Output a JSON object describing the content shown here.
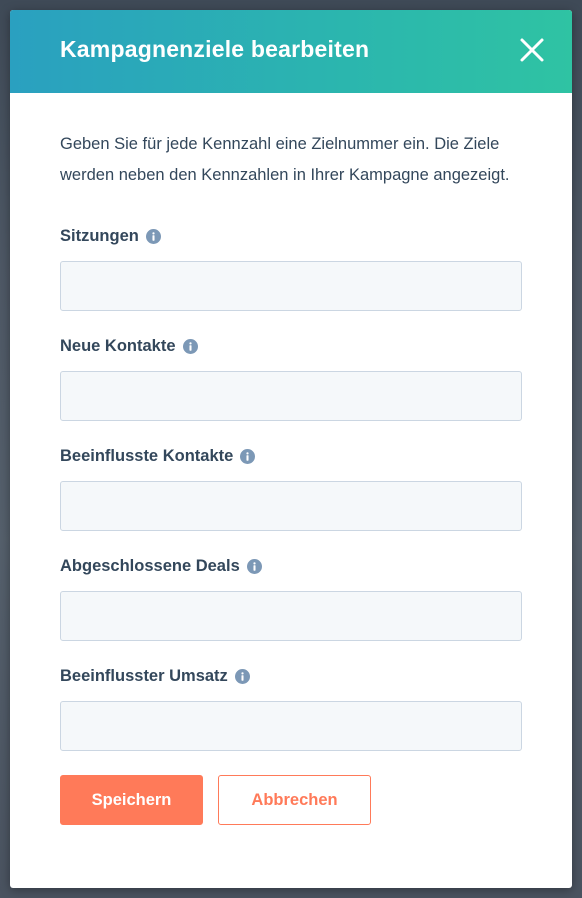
{
  "modal": {
    "title": "Kampagnenziele bearbeiten",
    "close_icon": "close-icon",
    "intro": "Geben Sie für jede Kennzahl eine Zielnummer ein. Die Ziele werden neben den Kennzahlen in Ihrer Kampagne angezeigt.",
    "fields": [
      {
        "label": "Sitzungen",
        "value": "",
        "icon": "info-icon"
      },
      {
        "label": "Neue Kontakte",
        "value": "",
        "icon": "info-icon"
      },
      {
        "label": "Beeinflusste Kontakte",
        "value": "",
        "icon": "info-icon"
      },
      {
        "label": "Abgeschlossene Deals",
        "value": "",
        "icon": "info-icon"
      },
      {
        "label": "Beeinflusster Umsatz",
        "value": "",
        "icon": "info-icon"
      }
    ],
    "buttons": {
      "save_label": "Speichern",
      "cancel_label": "Abbrechen"
    }
  },
  "colors": {
    "header_gradient_start": "#2aa0c0",
    "header_gradient_end": "#2fc3a3",
    "primary": "#ff7a59",
    "text": "#33475b",
    "input_bg": "#f5f8fa",
    "input_border": "#cbd6e2",
    "info_icon": "#7c98b6"
  }
}
